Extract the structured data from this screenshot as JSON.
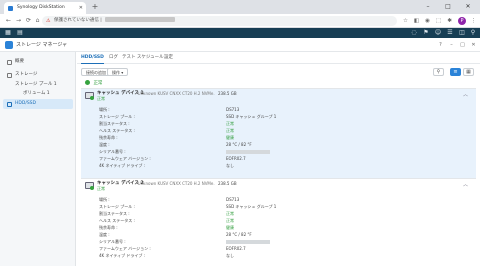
{
  "browser": {
    "tab_title": "Synology DiskStation",
    "warning": "⚠",
    "address_text": "保護されていない通信 |"
  },
  "app": {
    "title": "ストレージ マネージャ"
  },
  "sidebar": {
    "items": [
      {
        "label": "概要"
      },
      {
        "label": "ストレージ"
      },
      {
        "label": "ストレージ プール 1"
      },
      {
        "label": "ボリューム 1"
      },
      {
        "label": "HDD/SSD"
      }
    ]
  },
  "tabs": [
    {
      "label": "HDD/SSD"
    },
    {
      "label": "ログ"
    },
    {
      "label": "テスト スケジュール"
    },
    {
      "label": "設定"
    }
  ],
  "toolbar": {
    "add_drive": "接続の追加",
    "action": "操作 ▾"
  },
  "top_status": "正常",
  "drives": [
    {
      "name": "キャッシュ デバイス 1",
      "model": "- Unknown KUSV CNXX CT20 H.2 NVMe...",
      "size": "238.5 GB",
      "status": "正常",
      "fields": [
        {
          "k": "場所 :",
          "v": "DS713"
        },
        {
          "k": "ストレージ プール :",
          "v": "SSD キャッシュ グループ 1"
        },
        {
          "k": "割当ステータス :",
          "v": "正常",
          "good": true
        },
        {
          "k": "ヘルス ステータス :",
          "v": "正常",
          "good": true
        },
        {
          "k": "残余寿命 :",
          "v": "健康",
          "good": true
        },
        {
          "k": "温度 :",
          "v": "28 °C / 82 °F"
        },
        {
          "k": "シリアル番号 :",
          "v": "",
          "mask": true
        },
        {
          "k": "ファームウェア バージョン :",
          "v": "EOFR02.7"
        },
        {
          "k": "4K ネイティブ ドライブ :",
          "v": "なし"
        }
      ]
    },
    {
      "name": "キャッシュ デバイス 2",
      "model": "- Unknown KUSV CNXX CT20 H.2 NVMe...",
      "size": "238.5 GB",
      "status": "正常",
      "fields": [
        {
          "k": "場所 :",
          "v": "DS713"
        },
        {
          "k": "ストレージ プール :",
          "v": "SSD キャッシュ グループ 1"
        },
        {
          "k": "割当ステータス :",
          "v": "正常",
          "good": true
        },
        {
          "k": "ヘルス ステータス :",
          "v": "正常",
          "good": true
        },
        {
          "k": "残余寿命 :",
          "v": "健康",
          "good": true
        },
        {
          "k": "温度 :",
          "v": "28 °C / 82 °F"
        },
        {
          "k": "シリアル番号 :",
          "v": "",
          "mask": true
        },
        {
          "k": "ファームウェア バージョン :",
          "v": "EOFR02.7"
        },
        {
          "k": "4K ネイティブ ドライブ :",
          "v": "なし"
        }
      ]
    }
  ],
  "icons": {
    "back": "←",
    "forward": "→",
    "reload": "⟳",
    "home": "⌂",
    "star": "☆",
    "minimize": "–",
    "maximize": "□",
    "close": "✕",
    "new_tab": "+",
    "chevron_up": "︿",
    "filter": "⚲",
    "list": "≡",
    "grid": "▦"
  },
  "colors": {
    "accent": "#2b83d8",
    "dsm_bar": "#173e54",
    "ok": "#2e9c3a",
    "selected": "#e8f2fc"
  }
}
